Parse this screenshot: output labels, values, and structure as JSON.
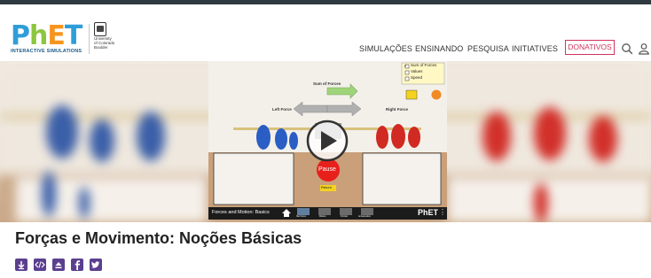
{
  "brand": {
    "logo_letters": [
      "P",
      "h",
      "E",
      "T"
    ],
    "logo_subtitle": "INTERACTIVE SIMULATIONS",
    "university": [
      "University",
      "of Colorado",
      "Boulder"
    ]
  },
  "nav": {
    "items": [
      "SIMULAÇÕES",
      "ENSINANDO",
      "PESQUISA",
      "INITIATIVES"
    ],
    "donate": "DONATIVOS",
    "search_icon": "search-icon",
    "user_icon": "user-icon"
  },
  "sim": {
    "checkboxes": [
      {
        "label": "Sum of Forces",
        "checked": true
      },
      {
        "label": "Values",
        "checked": false
      },
      {
        "label": "Speed",
        "checked": false
      }
    ],
    "sum_label": "Sum of Forces",
    "left_label": "Left Force",
    "right_label": "Right Force",
    "pause_label": "Pause",
    "return_label": "Return",
    "footer_title": "Forces and Motion: Basics",
    "footer_logo": "PhET",
    "tabs": [
      "Net Force",
      "Motion",
      "Friction",
      "Acceleration"
    ]
  },
  "page": {
    "title": "Forças e Movimento: Noções Básicas",
    "share_icons": [
      "download-icon",
      "embed-icon",
      "upload-icon",
      "facebook-icon",
      "twitter-icon"
    ]
  },
  "colors": {
    "accent": "#5b3f8f",
    "donate": "#d2335c",
    "pause": "#e8201c"
  }
}
